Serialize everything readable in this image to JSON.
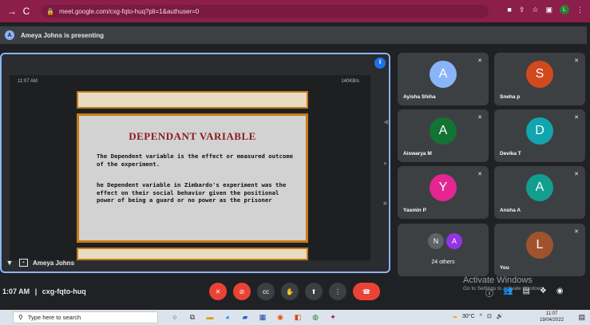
{
  "browser": {
    "back": "→",
    "reload": "C",
    "url": "meet.google.com/cxg-fqto-huq?pli=1&authuser=0",
    "profile_initial": "L"
  },
  "presenting": {
    "avatar_initial": "A",
    "text": "Ameya Johns is presenting"
  },
  "stage": {
    "phone_time": "11:07 AM",
    "phone_status": "140KB/s",
    "slide_title": "DEPENDANT VARIABLE",
    "slide_para1": "The Dependent variable is the effect or measured outcome of the experiment.",
    "slide_para2": "he Dependent variable in Zimbardo's experiment was the effect on their social behavior given the positional power of being a guard or no power as the prisoner",
    "presenter_name": "Ameya Johns"
  },
  "participants": [
    {
      "name": "Ayisha Shiha",
      "initial": "A",
      "color": "#8ab4f8",
      "muted": true
    },
    {
      "name": "Sneha p",
      "initial": "S",
      "color": "#d2491e",
      "muted": true
    },
    {
      "name": "Aiswarya M",
      "initial": "A",
      "color": "#137333",
      "muted": true
    },
    {
      "name": "Devika T",
      "initial": "D",
      "color": "#12a4af",
      "muted": true
    },
    {
      "name": "Yasmin P",
      "initial": "Y",
      "color": "#e52592",
      "muted": true
    },
    {
      "name": "Ansha A",
      "initial": "A",
      "color": "#129e8f",
      "muted": true
    }
  ],
  "others_tile": {
    "initials": [
      "N",
      "A"
    ],
    "colors": [
      "#5f6368",
      "#9334e6"
    ],
    "label": "24 others"
  },
  "you_tile": {
    "initial": "L",
    "color": "#a0522d",
    "name": "You"
  },
  "meeting": {
    "time": "1:07 AM",
    "separator": "|",
    "code": "cxg-fqto-huq"
  },
  "activate": {
    "line1": "Activate Windows",
    "line2": "Go to Settings to activate Windows."
  },
  "taskbar": {
    "search_placeholder": "Type here to search",
    "weather": "30°C",
    "clock_time": "11:07",
    "clock_date": "19/04/2022"
  }
}
